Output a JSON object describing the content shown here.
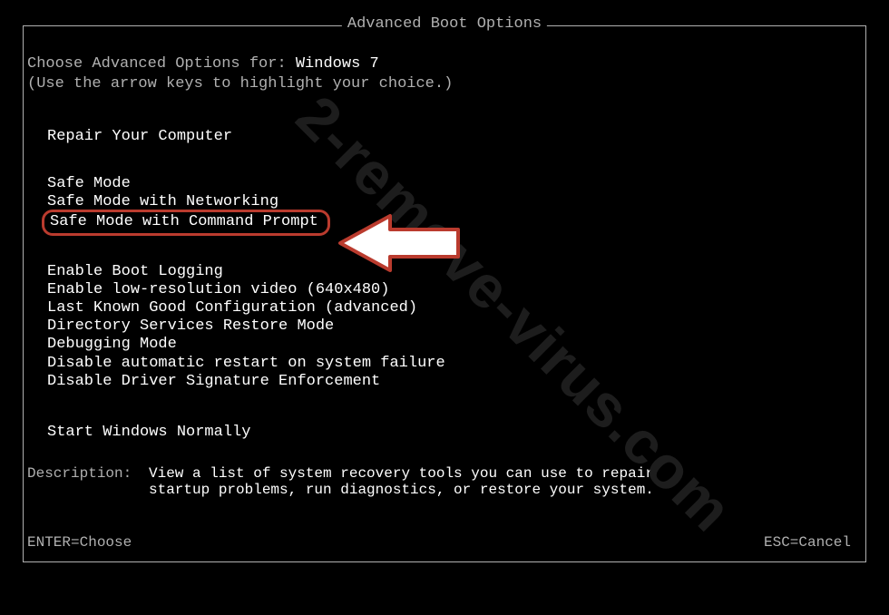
{
  "title": "Advanced Boot Options",
  "prompt_prefix": "Choose Advanced Options for: ",
  "os_name": "Windows 7",
  "hint": "(Use the arrow keys to highlight your choice.)",
  "repair": "Repair Your Computer",
  "safe_modes": {
    "sm": "Safe Mode",
    "smn": "Safe Mode with Networking",
    "smc": "Safe Mode with Command Prompt"
  },
  "opts": {
    "boot_log": "Enable Boot Logging",
    "low_res": "Enable low-resolution video (640x480)",
    "last_known": "Last Known Good Configuration (advanced)",
    "dsrm": "Directory Services Restore Mode",
    "debug": "Debugging Mode",
    "no_restart": "Disable automatic restart on system failure",
    "no_sig": "Disable Driver Signature Enforcement"
  },
  "start_normal": "Start Windows Normally",
  "description_label": "Description:",
  "description_text": "View a list of system recovery tools you can use to repair startup problems, run diagnostics, or restore your system.",
  "footer_enter": "ENTER=Choose",
  "footer_esc": "ESC=Cancel",
  "watermark": "2-remove-virus.com"
}
